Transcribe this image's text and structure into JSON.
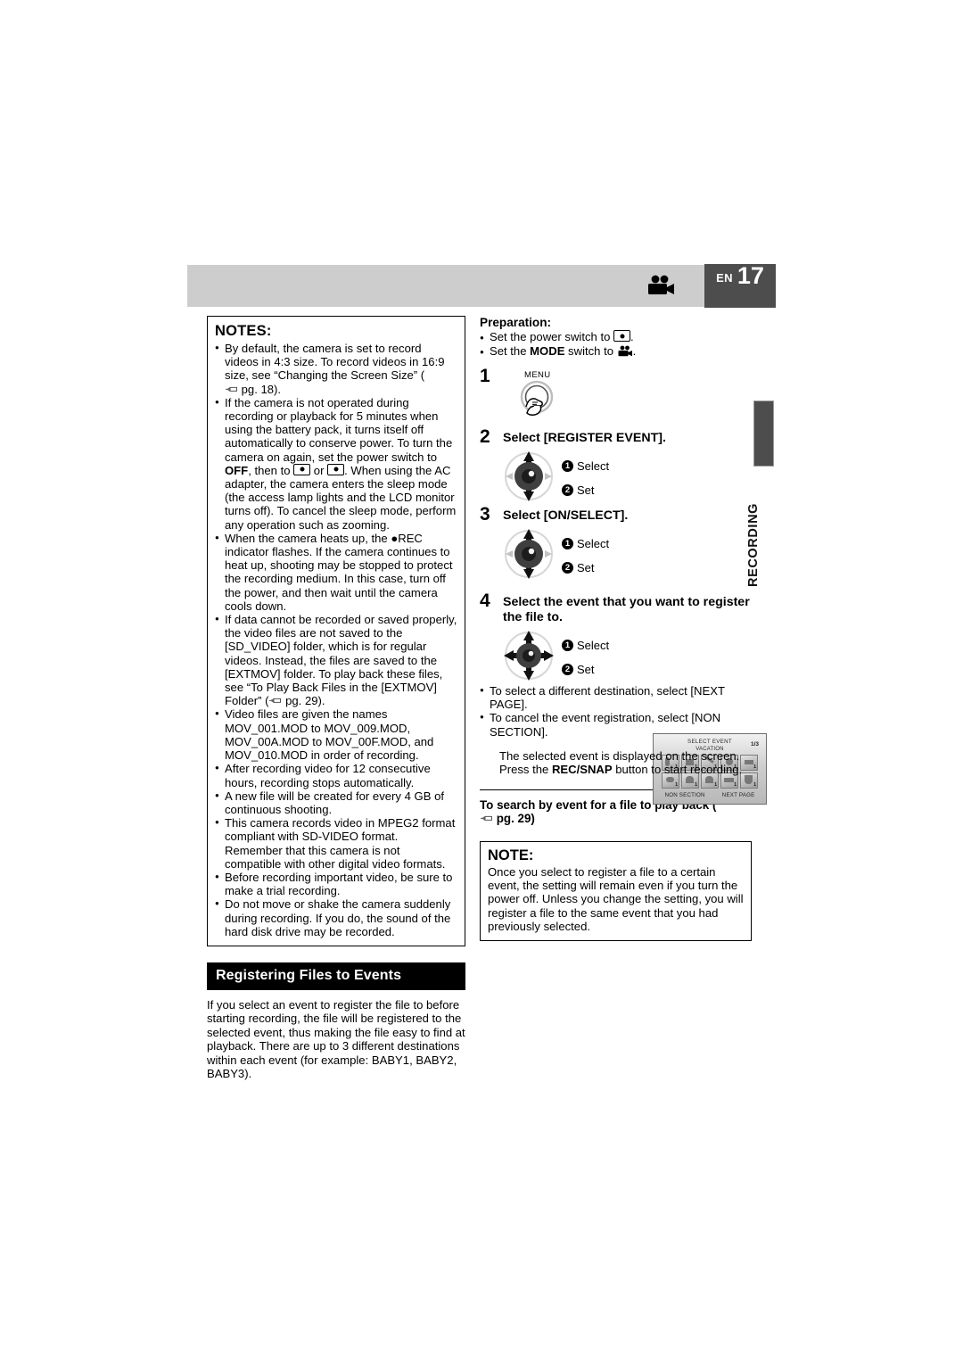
{
  "header": {
    "lang_code": "EN",
    "page_number": "17",
    "camera_icon": "video-camera-icon"
  },
  "side_tab": {
    "label": "RECORDING"
  },
  "notes_box": {
    "title": "NOTES:",
    "items": [
      "By default, the camera is set to record videos in 4:3 size. To record videos in 16:9 size, see “Changing the Screen Size” ( pg. 18).",
      "If the camera is not operated during recording or playback for 5 minutes when using the battery pack, it turns itself off automatically to conserve power. To turn the camera on again, set the power switch to OFF, then to  or  . When using the AC adapter, the camera enters the sleep mode (the access lamp lights and the LCD monitor turns off). To cancel the sleep mode, perform any operation such as zooming.",
      "When the camera heats up, the ●REC indicator flashes. If the camera continues to heat up, shooting may be stopped to protect the recording medium. In this case, turn off the power, and then wait until the camera cools down.",
      "If data cannot be recorded or saved properly, the video files are not saved to the [SD_VIDEO] folder, which is for regular videos. Instead, the files are saved to the [EXTMOV] folder. To play back these files, see “To Play Back Files in the [EXTMOV] Folder” ( pg. 29).",
      "Video files are given the names MOV_001.MOD to MOV_009.MOD, MOV_00A.MOD to MOV_00F.MOD, and MOV_010.MOD in order of recording.",
      "After recording video for 12 consecutive hours, recording stops automatically.",
      "A new file will be created for every 4 GB of continuous shooting.",
      "This camera records video in MPEG2 format compliant with SD-VIDEO format. Remember that this camera is not compatible with other digital video formats.",
      "Before recording important video, be sure to make a trial recording.",
      "Do not move or shake the camera suddenly during recording. If you do, the sound of the hard disk drive may be recorded."
    ]
  },
  "section": {
    "title": "Registering Files to Events",
    "body": "If you select an event to register the file to before starting recording, the file will be registered to the selected event, thus making the file easy to find at playback. There are up to 3 different destinations within each event (for example: BABY1, BABY2, BABY3)."
  },
  "preparation": {
    "title": "Preparation:",
    "items": [
      "Set the power switch to  .",
      "Set the MODE switch to  ."
    ]
  },
  "steps": [
    {
      "number": "1",
      "title": "",
      "button_label": "MENU"
    },
    {
      "number": "2",
      "title": "Select [REGISTER EVENT].",
      "callouts": [
        {
          "marker": "1",
          "label": "Select"
        },
        {
          "marker": "2",
          "label": "Set"
        }
      ]
    },
    {
      "number": "3",
      "title": "Select [ON/SELECT].",
      "callouts": [
        {
          "marker": "1",
          "label": "Select"
        },
        {
          "marker": "2",
          "label": "Set"
        }
      ]
    },
    {
      "number": "4",
      "title": "Select the event that you want to register the file to.",
      "callouts": [
        {
          "marker": "1",
          "label": "Select"
        },
        {
          "marker": "2",
          "label": "Set"
        }
      ]
    }
  ],
  "lcd_screen": {
    "title": "SELECT EVENT",
    "page_indicator": "1/3",
    "subtitle": "VACATION",
    "cells": [
      {
        "badge": "1"
      },
      {
        "badge": "1"
      },
      {
        "badge": "1"
      },
      {
        "badge": "1"
      },
      {
        "badge": "1"
      },
      {
        "badge": "1"
      },
      {
        "badge": "1"
      },
      {
        "badge": "1"
      },
      {
        "badge": "1"
      },
      {
        "badge": "1"
      }
    ],
    "footer_left": "NON SECTION",
    "footer_right": "NEXT PAGE"
  },
  "step4_notes": [
    "To select a different destination, select [NEXT PAGE].",
    "To cancel the event registration, select [NON SECTION]."
  ],
  "result_text": "The selected event is displayed on the screen. Press the REC/SNAP button to start recording.",
  "search_line": "To search by event for a file to play back ( pg. 29)",
  "note_box": {
    "title": "NOTE:",
    "body": "Once you select to register a file to a certain event, the setting will remain even if you turn the power off. Unless you change the setting, you will register a file to the same event that you had previously selected."
  },
  "colors": {
    "header_bar": "#cdcdcd",
    "page_box": "#4d4d4d",
    "section_bar": "#000000"
  }
}
